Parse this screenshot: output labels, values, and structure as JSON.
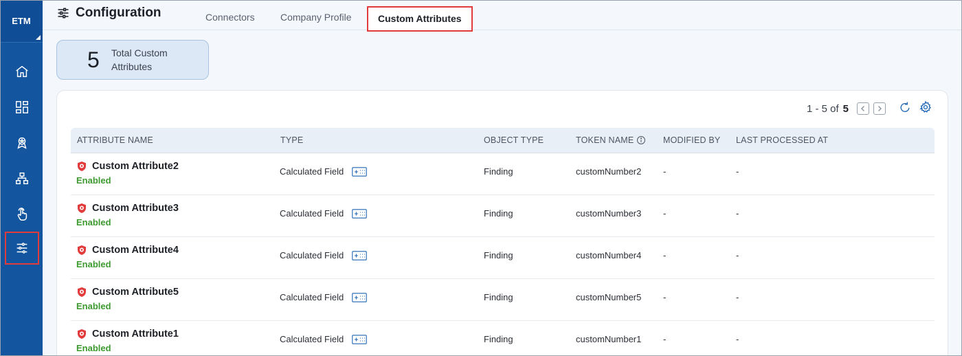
{
  "sidebar": {
    "brand": "ETM",
    "items": [
      {
        "name": "home-icon"
      },
      {
        "name": "dashboard-icon"
      },
      {
        "name": "badge-icon"
      },
      {
        "name": "hierarchy-icon"
      },
      {
        "name": "touch-icon"
      },
      {
        "name": "sliders-icon",
        "active": true
      }
    ]
  },
  "header": {
    "title": "Configuration",
    "tabs": [
      {
        "label": "Connectors"
      },
      {
        "label": "Company Profile"
      },
      {
        "label": "Custom Attributes",
        "active": true
      }
    ]
  },
  "summary": {
    "count": "5",
    "label": "Total Custom Attributes"
  },
  "pager": {
    "range": "1 - 5 of",
    "total": "5"
  },
  "table": {
    "columns": [
      "ATTRIBUTE NAME",
      "TYPE",
      "OBJECT TYPE",
      "TOKEN NAME",
      "MODIFIED BY",
      "LAST PROCESSED AT"
    ],
    "rows": [
      {
        "name": "Custom Attribute2",
        "status": "Enabled",
        "type": "Calculated Field",
        "object_type": "Finding",
        "token": "customNumber2",
        "modified_by": "-",
        "last_processed": "-"
      },
      {
        "name": "Custom Attribute3",
        "status": "Enabled",
        "type": "Calculated Field",
        "object_type": "Finding",
        "token": "customNumber3",
        "modified_by": "-",
        "last_processed": "-"
      },
      {
        "name": "Custom Attribute4",
        "status": "Enabled",
        "type": "Calculated Field",
        "object_type": "Finding",
        "token": "customNumber4",
        "modified_by": "-",
        "last_processed": "-"
      },
      {
        "name": "Custom Attribute5",
        "status": "Enabled",
        "type": "Calculated Field",
        "object_type": "Finding",
        "token": "customNumber5",
        "modified_by": "-",
        "last_processed": "-"
      },
      {
        "name": "Custom Attribute1",
        "status": "Enabled",
        "type": "Calculated Field",
        "object_type": "Finding",
        "token": "customNumber1",
        "modified_by": "-",
        "last_processed": "-"
      }
    ]
  },
  "colors": {
    "sidebar": "#13559e",
    "accent_red": "#e23b3b",
    "enabled_green": "#3c9a2f"
  }
}
